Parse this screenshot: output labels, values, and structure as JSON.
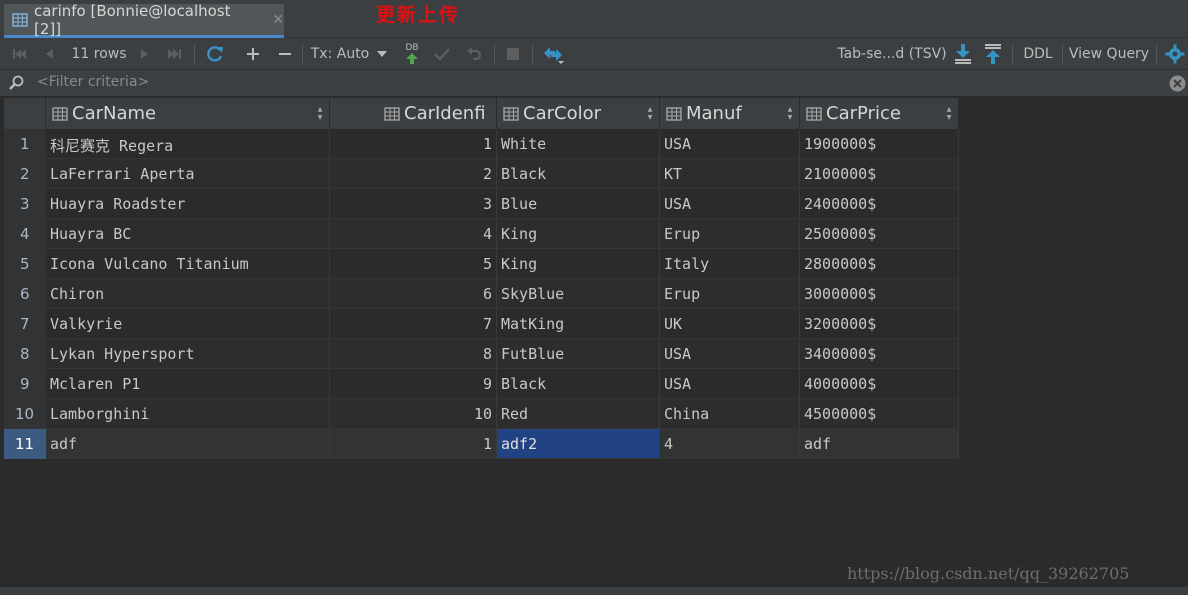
{
  "tab": {
    "title": "carinfo [Bonnie@localhost [2]]",
    "close": "✕"
  },
  "annotation": "更新上传",
  "toolbar": {
    "rows_label": "11 rows",
    "tx_label": "Tx: Auto",
    "db_label": "DB",
    "format_label": "Tab-se...d (TSV)",
    "ddl_label": "DDL",
    "view_query_label": "View Query"
  },
  "filter": {
    "placeholder": "<Filter criteria>"
  },
  "columns": [
    "CarName",
    "CarIdenfi",
    "CarColor",
    "Manuf",
    "CarPrice"
  ],
  "rows": [
    {
      "num": "1",
      "cells": [
        "科尼赛克 Regera",
        "1",
        "White",
        "USA",
        "1900000$"
      ]
    },
    {
      "num": "2",
      "cells": [
        "LaFerrari Aperta",
        "2",
        "Black",
        "KT",
        "2100000$"
      ]
    },
    {
      "num": "3",
      "cells": [
        "Huayra Roadster",
        "3",
        "Blue",
        "USA",
        "2400000$"
      ]
    },
    {
      "num": "4",
      "cells": [
        "Huayra BC",
        "4",
        "King",
        "Erup",
        "2500000$"
      ]
    },
    {
      "num": "5",
      "cells": [
        "Icona Vulcano Titanium",
        "5",
        "King",
        "Italy",
        "2800000$"
      ]
    },
    {
      "num": "6",
      "cells": [
        "Chiron",
        "6",
        "SkyBlue",
        "Erup",
        "3000000$"
      ]
    },
    {
      "num": "7",
      "cells": [
        "Valkyrie",
        "7",
        "MatKing",
        "UK",
        "3200000$"
      ]
    },
    {
      "num": "8",
      "cells": [
        "Lykan Hypersport",
        "8",
        "FutBlue",
        "USA",
        "3400000$"
      ]
    },
    {
      "num": "9",
      "cells": [
        "Mclaren P1",
        "9",
        "Black",
        "USA",
        "4000000$"
      ]
    },
    {
      "num": "10",
      "cells": [
        "Lamborghini",
        "10",
        "Red",
        "China",
        "4500000$"
      ]
    },
    {
      "num": "11",
      "cells": [
        "adf",
        "1",
        "adf2",
        "4",
        "adf"
      ]
    }
  ],
  "watermark": "https://blog.csdn.net/qq_39262705",
  "colors": {
    "accent": "#4a88c7",
    "selected_cell": "#214283",
    "annotation": "#e01010"
  }
}
